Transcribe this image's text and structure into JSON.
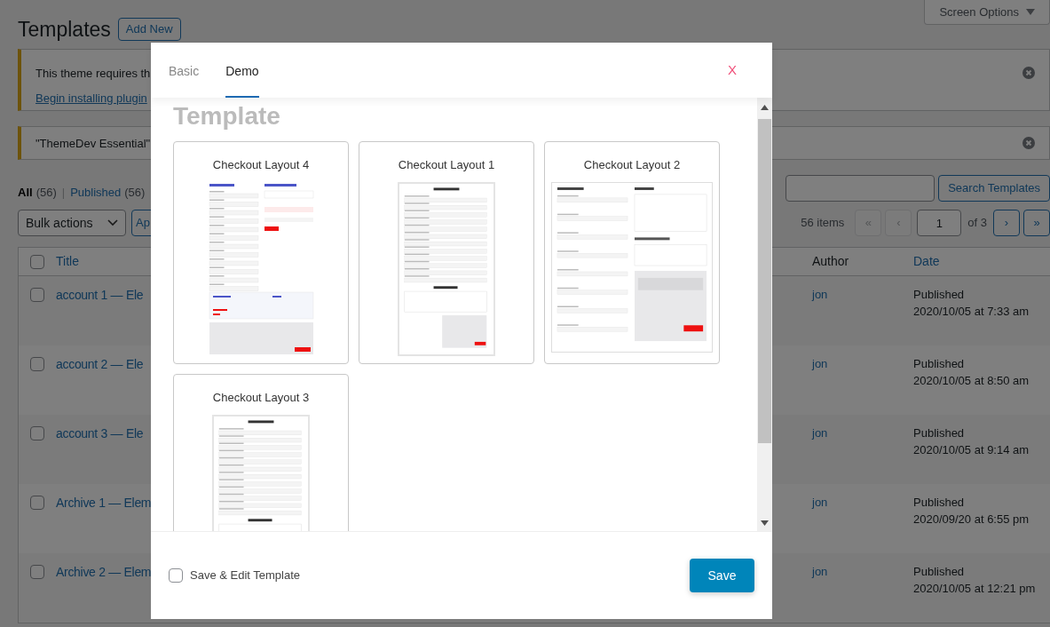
{
  "page": {
    "title": "Templates",
    "add_new": "Add New",
    "screen_options": "Screen Options"
  },
  "notices": [
    {
      "text": "This theme requires th",
      "link": "Begin installing plugin"
    },
    {
      "text": "\"ThemeDev Essential\""
    }
  ],
  "filters": [
    {
      "label": "All",
      "count": "(56)",
      "selected": true
    },
    {
      "label": "Published",
      "count": "(56)",
      "selected": false
    }
  ],
  "filter_separator": "|",
  "bulk_actions": "Bulk actions",
  "apply": "Ap",
  "search_button": "Search Templates",
  "items_count": "56 items",
  "pagination": {
    "first": "«",
    "prev": "‹",
    "page": "1",
    "of": "of 3",
    "next": "›",
    "last": "»"
  },
  "table": {
    "columns": [
      "Title",
      "Author",
      "Date"
    ],
    "select_all_checked": false,
    "rows": [
      {
        "checked": false,
        "title": "account 1 — Ele",
        "author": "jon",
        "status": "Published",
        "date": "2020/10/05 at 7:33 am"
      },
      {
        "checked": false,
        "title": "account 2 — Ele",
        "author": "jon",
        "status": "Published",
        "date": "2020/10/05 at 8:50 am"
      },
      {
        "checked": false,
        "title": "account 3 — Ele",
        "author": "jon",
        "status": "Published",
        "date": "2020/10/05 at 9:14 am"
      },
      {
        "checked": false,
        "title": "Archive 1 — Elem",
        "author": "jon",
        "status": "Published",
        "date": "2020/09/20 at 6:55 pm"
      },
      {
        "checked": false,
        "title": "Archive 2 — Elem",
        "author": "jon",
        "status": "Published",
        "date": "2020/10/05 at 12:21 pm"
      }
    ]
  },
  "modal": {
    "tabs": [
      {
        "label": "Basic",
        "selected": false
      },
      {
        "label": "Demo",
        "selected": true
      }
    ],
    "close": "X",
    "heading": "Template",
    "templates": [
      {
        "name": "Checkout Layout 4",
        "kind": "two-column"
      },
      {
        "name": "Checkout Layout 1",
        "kind": "single-column"
      },
      {
        "name": "Checkout Layout 2",
        "kind": "wide"
      },
      {
        "name": "Checkout Layout 3",
        "kind": "single-column"
      }
    ],
    "save_edit": {
      "label": "Save & Edit Template",
      "checked": false
    },
    "save": "Save"
  }
}
